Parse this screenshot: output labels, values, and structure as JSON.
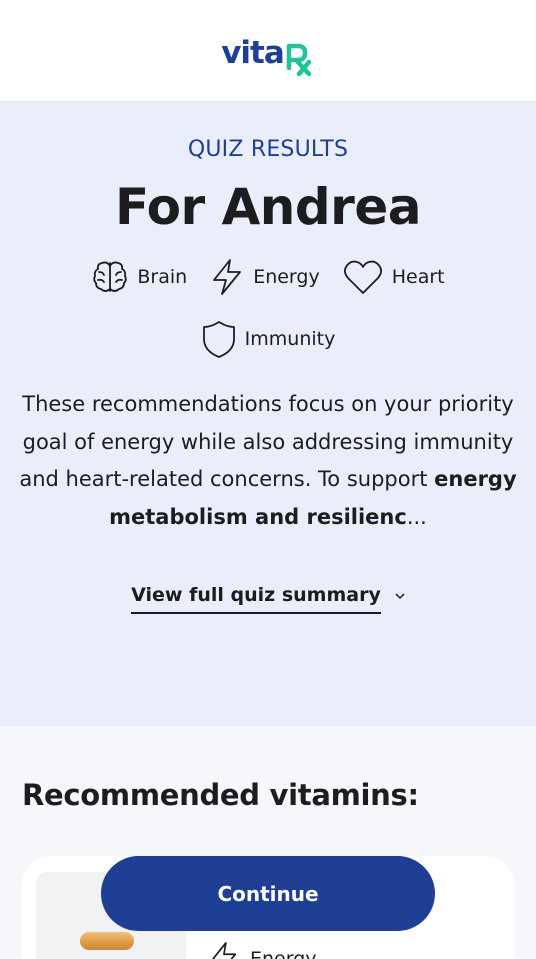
{
  "brand": {
    "logo_text": "vita",
    "logo_rx": "Rx",
    "colors": {
      "primary": "#1e3f94",
      "accent": "#22c39a"
    }
  },
  "hero": {
    "eyebrow": "QUIZ RESULTS",
    "title": "For Andrea",
    "goals": [
      {
        "icon": "brain-icon",
        "label": "Brain"
      },
      {
        "icon": "lightning-icon",
        "label": "Energy"
      },
      {
        "icon": "heart-icon",
        "label": "Heart"
      },
      {
        "icon": "shield-icon",
        "label": "Immunity"
      }
    ],
    "summary_plain": "These recommendations focus on your priority goal of energy while also addressing immunity and heart-related concerns. To support ",
    "summary_bold": "energy metabolism and resilienc",
    "summary_ellipsis": "...",
    "view_summary_label": "View full quiz summary"
  },
  "recommendations": {
    "heading": "Recommended vitamins:",
    "cards": [
      {
        "tag_icon": "lightning-icon",
        "tag_label": "Energy"
      }
    ]
  },
  "cta": {
    "continue_label": "Continue"
  }
}
